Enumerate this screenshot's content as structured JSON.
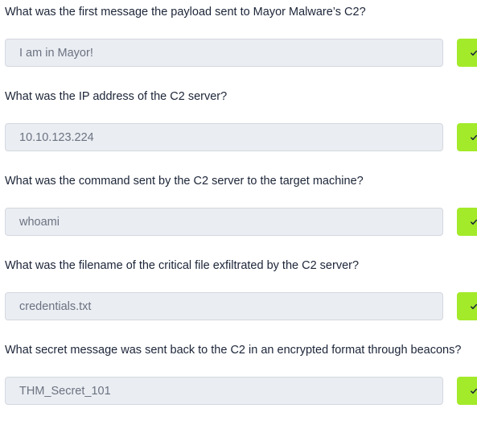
{
  "questions": [
    {
      "question": "What was the first message the payload sent to Mayor Malware’s C2?",
      "answer": "I am in Mayor!",
      "status": "correct"
    },
    {
      "question": "What was the IP address of the C2 server?",
      "answer": "10.10.123.224",
      "status": "correct"
    },
    {
      "question": "What was the command sent by the C2 server to the target machine?",
      "answer": "whoami",
      "status": "correct"
    },
    {
      "question": "What was the filename of the critical file exfiltrated by the C2 server?",
      "answer": "credentials.txt",
      "status": "correct"
    },
    {
      "question": "What secret message was sent back to the C2 in an encrypted format through beacons?",
      "answer": "THM_Secret_101",
      "status": "correct"
    }
  ],
  "colors": {
    "submit_accent": "#a3ea2a",
    "field_background": "#eaedf2",
    "question_text": "#1c2538",
    "answer_text": "#6b7280"
  },
  "icons": {
    "submit": "check-icon"
  }
}
